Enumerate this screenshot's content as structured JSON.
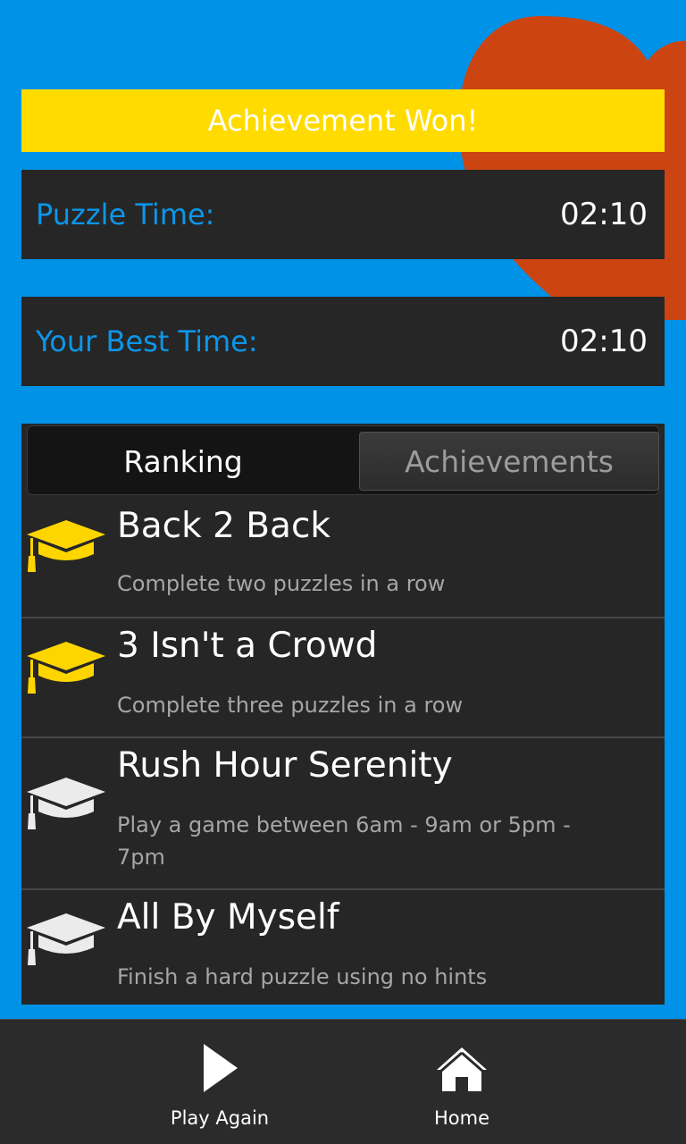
{
  "colors": {
    "background": "#0092e6",
    "heart": "#cc4411",
    "banner": "#ffdb00",
    "panel": "#262626",
    "label_blue": "#0c96e9",
    "cap_earned": "#ffd500",
    "cap_locked": "#ebebeb"
  },
  "banner": {
    "text": "Achievement Won!"
  },
  "puzzle_time": {
    "label": "Puzzle Time:",
    "value": "02:10"
  },
  "best_time": {
    "label": "Your Best Time:",
    "value": "02:10"
  },
  "tabs": {
    "ranking": "Ranking",
    "achievements": "Achievements",
    "selected": "Ranking"
  },
  "achievements": [
    {
      "title": "Back 2 Back",
      "description": "Complete two puzzles in a row",
      "earned": true,
      "icon": "graduation-cap-icon"
    },
    {
      "title": "3 Isn't a Crowd",
      "description": "Complete three puzzles in a row",
      "earned": true,
      "icon": "graduation-cap-icon"
    },
    {
      "title": "Rush Hour Serenity",
      "description": "Play a game between 6am - 9am or 5pm - 7pm",
      "earned": false,
      "icon": "graduation-cap-icon"
    },
    {
      "title": "All By Myself",
      "description": "Finish a hard puzzle using no hints",
      "earned": false,
      "icon": "graduation-cap-icon"
    }
  ],
  "actions": {
    "play_again": {
      "label": "Play Again",
      "icon": "play-icon"
    },
    "home": {
      "label": "Home",
      "icon": "home-icon"
    }
  }
}
